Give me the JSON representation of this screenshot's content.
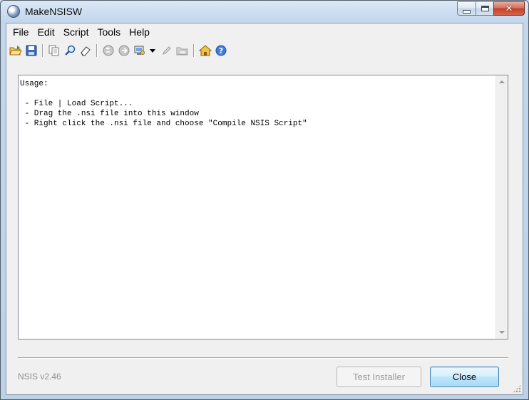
{
  "window": {
    "title": "MakeNSISW"
  },
  "menu": [
    "File",
    "Edit",
    "Script",
    "Tools",
    "Help"
  ],
  "toolbar": {
    "icons": [
      "open-script-icon",
      "save-output-icon",
      "copy-icon",
      "find-icon",
      "clear-log-icon",
      "recompile-icon",
      "test-installer-icon",
      "compressor-icon",
      "edit-script-icon",
      "browse-script-icon",
      "nsis-home-icon",
      "help-icon"
    ]
  },
  "editor": {
    "text": "Usage:\n\n - File | Load Script...\n - Drag the .nsi file into this window\n - Right click the .nsi file and choose \"Compile NSIS Script\""
  },
  "footer": {
    "version": "NSIS v2.46",
    "test_label": "Test Installer",
    "close_label": "Close"
  },
  "colors": {
    "accent": "#3c7fb1",
    "close_caption": "#c2412a",
    "disabled_text": "#9a9a9a"
  }
}
